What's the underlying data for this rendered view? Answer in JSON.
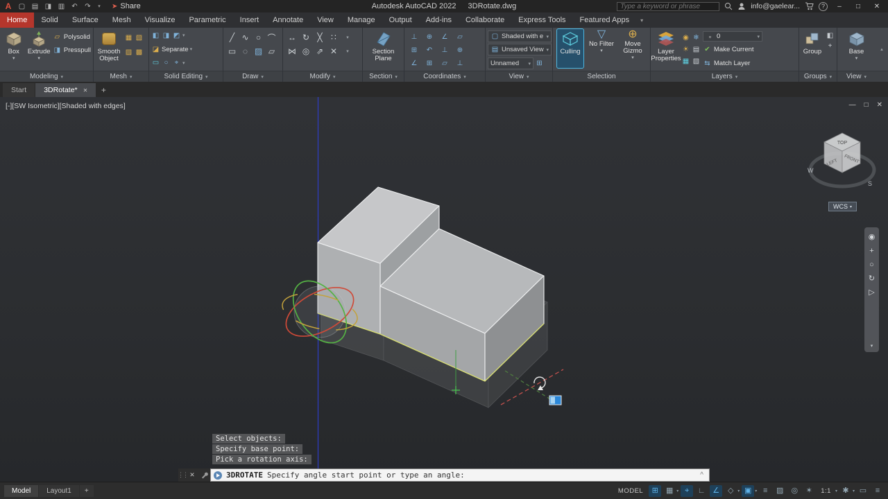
{
  "titlebar": {
    "app_title": "Autodesk AutoCAD 2022",
    "doc_name": "3DRotate.dwg",
    "share": "Share",
    "search_placeholder": "Type a keyword or phrase",
    "account": "info@gaelear...",
    "help": "?",
    "minimize": "–",
    "maximize": "□",
    "close": "✕"
  },
  "ribbon": {
    "tabs": [
      "Home",
      "Solid",
      "Surface",
      "Mesh",
      "Visualize",
      "Parametric",
      "Insert",
      "Annotate",
      "View",
      "Manage",
      "Output",
      "Add-ins",
      "Collaborate",
      "Express Tools",
      "Featured Apps"
    ],
    "modeling": {
      "title": "Modeling",
      "box": "Box",
      "extrude": "Extrude",
      "polysolid": "Polysolid",
      "presspull": "Presspull"
    },
    "mesh": {
      "title": "Mesh",
      "smooth_object": "Smooth Object"
    },
    "solid_editing": {
      "title": "Solid Editing",
      "separate": "Separate"
    },
    "draw": {
      "title": "Draw"
    },
    "modify": {
      "title": "Modify"
    },
    "section": {
      "title": "Section",
      "section_plane": "Section Plane"
    },
    "coordinates": {
      "title": "Coordinates"
    },
    "view_controls": {
      "title": "View",
      "visual_style": "Shaded with e...",
      "named_view": "Unsaved View",
      "viewport_label": "Unnamed"
    },
    "selection": {
      "title": "Selection",
      "culling": "Culling",
      "no_filter": "No Filter",
      "move_gizmo": "Move Gizmo"
    },
    "layers": {
      "title": "Layers",
      "layer_properties": "Layer Properties",
      "current_layer": "0",
      "make_current": "Make Current",
      "match_layer": "Match Layer"
    },
    "groups": {
      "title": "Groups",
      "group": "Group"
    },
    "view_panel": {
      "title": "View",
      "base": "Base"
    }
  },
  "file_tabs": {
    "start": "Start",
    "active_doc": "3DRotate*"
  },
  "viewport": {
    "controls_label": "[-]",
    "view_label": "[SW Isometric]",
    "style_label": "[Shaded with edges]",
    "viewcube": {
      "top": "TOP",
      "left": "LEFT",
      "front": "FRONT",
      "west": "W",
      "south": "S",
      "wcs": "WCS"
    },
    "window": {
      "minimize": "—",
      "restore": "□",
      "close": "✕"
    },
    "prompts": [
      "Select objects:",
      "Specify base point:",
      "Pick a rotation axis:"
    ],
    "command_name": "3DROTATE",
    "command_prompt": "Specify angle start point or type an angle:",
    "history_toggle": "^"
  },
  "statusbar": {
    "model_tab": "Model",
    "layout_tab": "Layout1",
    "new_layout": "+",
    "space": "MODEL",
    "scale": "1:1"
  },
  "colors": {
    "accent_red": "#b5362c",
    "selection_blue": "#4fb7e0",
    "gizmo_red": "#cf4a38",
    "gizmo_green": "#55b244",
    "gizmo_gold": "#c3a23c",
    "axis_blue": "#2e3ecf"
  },
  "icons": {
    "caret": "▾",
    "caret_up": "▴",
    "close": "✕",
    "plus": "+",
    "dots": "⋮",
    "undo": "↶",
    "redo": "↷",
    "new_doc": "▢",
    "open_doc": "▤",
    "save_doc": "◨",
    "plot_doc": "▥",
    "share_arrow": "➤",
    "logo": "A",
    "line": "╱",
    "polyline": "∿",
    "circle": "○",
    "arc": "⌒",
    "rect": "▭",
    "ellipse": "◌",
    "hatch": "▨",
    "polygon": "▱",
    "move": "↔",
    "rotate": "↻",
    "trim": "╳",
    "array": "∷",
    "mirror": "⋈",
    "offset": "◎",
    "scale": "⇗",
    "ucs": "⊥",
    "ucs_world": "⊕",
    "ucs_angle": "∠",
    "ucs_grid": "⊞",
    "ucs_view": "▱",
    "mesh1": "▦",
    "mesh2": "▧",
    "mesh3": "▨",
    "mesh4": "▩",
    "se_union": "◧",
    "se_subtract": "◨",
    "se_intersect": "◩",
    "se_separate": "◪",
    "vs_cube": "▢",
    "funnel": "▽",
    "gizmo": "⊕",
    "sun": "☀",
    "bulb": "◉",
    "freeze": "❄",
    "layer_mini": "▤",
    "check": "✔",
    "match": "⇆",
    "white_chip": "▫",
    "grid": "⊞",
    "snap": "▦",
    "ortho": "∟",
    "polar": "∠",
    "iso": "◇",
    "osnap": "▣",
    "lineweight": "≡",
    "transparency": "▨",
    "cycling": "◎",
    "annot": "✶",
    "gear": "✱",
    "clean": "▭",
    "target": "⌖",
    "menu": "≡",
    "nav_wheel": "◉",
    "nav_pan": "+",
    "nav_zoom": "○",
    "nav_orbit": "↻",
    "nav_motion": "▷"
  }
}
